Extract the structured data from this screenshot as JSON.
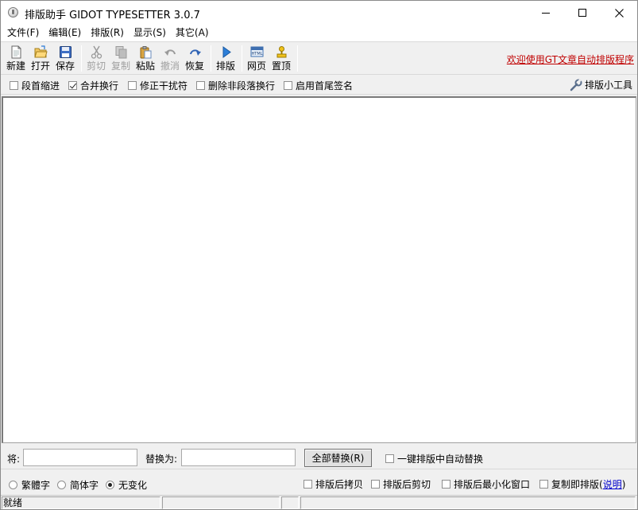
{
  "window": {
    "title": "排版助手 GIDOT TYPESETTER 3.0.7"
  },
  "menu": [
    "文件(F)",
    "编辑(E)",
    "排版(R)",
    "显示(S)",
    "其它(A)"
  ],
  "toolbar": {
    "buttons": [
      {
        "label": "新建",
        "icon": "new-document-icon",
        "enabled": true
      },
      {
        "label": "打开",
        "icon": "open-folder-icon",
        "enabled": true
      },
      {
        "label": "保存",
        "icon": "save-disk-icon",
        "enabled": true
      },
      {
        "label": "剪切",
        "icon": "scissors-icon",
        "enabled": false
      },
      {
        "label": "复制",
        "icon": "copy-icon",
        "enabled": false
      },
      {
        "label": "粘贴",
        "icon": "paste-clipboard-icon",
        "enabled": true
      },
      {
        "label": "撤消",
        "icon": "undo-arrow-icon",
        "enabled": false
      },
      {
        "label": "恢复",
        "icon": "redo-arrow-icon",
        "enabled": true
      },
      {
        "label": "排版",
        "icon": "play-triangle-icon",
        "enabled": true
      },
      {
        "label": "网页",
        "icon": "html-page-icon",
        "enabled": true
      },
      {
        "label": "置顶",
        "icon": "pin-top-icon",
        "enabled": true
      }
    ],
    "welcome_link": "欢迎使用GT文章自动排版程序"
  },
  "options": {
    "items": [
      {
        "label": "段首缩进",
        "checked": false
      },
      {
        "label": "合并换行",
        "checked": true
      },
      {
        "label": "修正干扰符",
        "checked": false
      },
      {
        "label": "删除非段落换行",
        "checked": false
      },
      {
        "label": "启用首尾签名",
        "checked": false
      }
    ],
    "tools_label": "排版小工具"
  },
  "editor": {
    "content": ""
  },
  "replace": {
    "find_label": "将:",
    "find_value": "",
    "replace_label": "替换为:",
    "replace_value": "",
    "replace_all_button": "全部替换(R)",
    "auto_replace_label": "一键排版中自动替换",
    "auto_replace_checked": false
  },
  "conversion": {
    "radios": [
      {
        "label": "繁體字",
        "checked": false
      },
      {
        "label": "简体字",
        "checked": false
      },
      {
        "label": "无变化",
        "checked": true
      }
    ],
    "after_options": [
      {
        "label": "排版后拷贝",
        "checked": false
      },
      {
        "label": "排版后剪切",
        "checked": false
      },
      {
        "label": "排版后最小化窗口",
        "checked": false
      }
    ],
    "copy_typeset_label": "复制即排版(",
    "copy_typeset_help": "说明",
    "copy_typeset_close": ")",
    "copy_typeset_checked": false
  },
  "status": {
    "text": "就绪"
  },
  "colors": {
    "link_red": "#c00000",
    "link_blue": "#0000cc",
    "chrome": "#f0f0f0"
  }
}
